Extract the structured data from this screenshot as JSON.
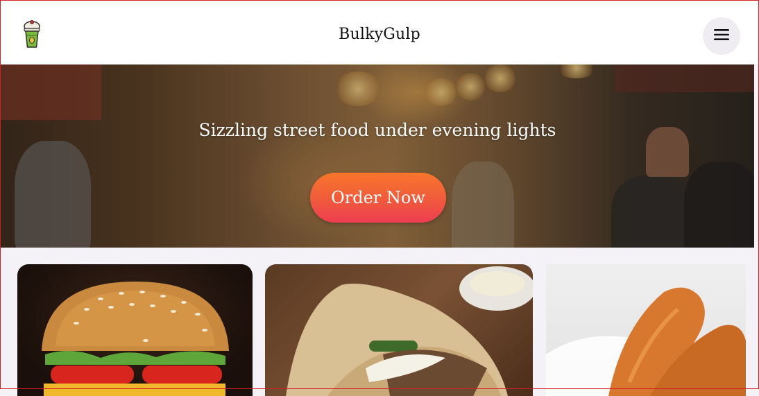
{
  "header": {
    "brand": "BulkyGulp",
    "logo_icon": "drink-cup-icon",
    "menu_icon": "hamburger-menu-icon"
  },
  "hero": {
    "title": "Sizzling street food under evening lights",
    "cta_label": "Order Now",
    "cta_gradient": [
      "#f7762a",
      "#ee3d52"
    ]
  },
  "cards": [
    {
      "name": "burger",
      "image": "burger-image"
    },
    {
      "name": "wrap",
      "image": "shawarma-wrap-image"
    },
    {
      "name": "fried-chicken",
      "image": "fried-chicken-image"
    }
  ],
  "colors": {
    "page_bg": "#f4f2f7",
    "header_bg": "#ffffff",
    "menu_button_bg": "#efedf1"
  }
}
